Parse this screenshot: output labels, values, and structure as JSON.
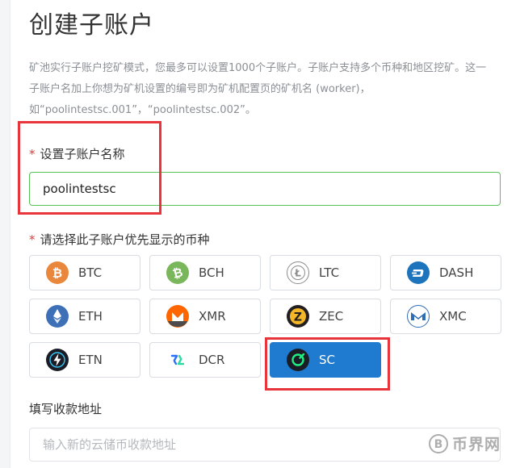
{
  "page": {
    "title": "创建子账户",
    "intro_lines": [
      "矿池实行子账户挖矿模式，您最多可以设置1000个子账户。子账户支持多个币种和地区挖矿。这一",
      "子账户名加上你想为矿机设置的编号即为矿机配置页的矿机名 (worker)，",
      "如“poolintestsc.001”，“poolintestsc.002”。"
    ]
  },
  "form": {
    "required_mark": "*",
    "name_label": "设置子账户名称",
    "name_value": "poolintestsc",
    "coin_label": "请选择此子账户优先显示的币种",
    "address_label": "填写收款地址",
    "address_placeholder": "输入新的云储币收款地址"
  },
  "coins": [
    {
      "name": "BTC",
      "icon": "btc-icon",
      "color": "#e9873c",
      "selected": false
    },
    {
      "name": "BCH",
      "icon": "bch-icon",
      "color": "#7ab75c",
      "selected": false
    },
    {
      "name": "LTC",
      "icon": "ltc-icon",
      "color": "#8c8c8c",
      "selected": false
    },
    {
      "name": "DASH",
      "icon": "dash-icon",
      "color": "#1c75bc",
      "selected": false
    },
    {
      "name": "ETH",
      "icon": "eth-icon",
      "color": "#3e70b7",
      "selected": false
    },
    {
      "name": "XMR",
      "icon": "xmr-icon",
      "color": "#ff6600",
      "selected": false
    },
    {
      "name": "ZEC",
      "icon": "zec-icon",
      "color": "#231f20",
      "selected": false
    },
    {
      "name": "XMC",
      "icon": "xmc-icon",
      "color": "#2e6db4",
      "selected": false
    },
    {
      "name": "ETN",
      "icon": "etn-icon",
      "color": "#1b1d26",
      "selected": false
    },
    {
      "name": "DCR",
      "icon": "dcr-icon",
      "color": "#2970ff",
      "selected": false
    },
    {
      "name": "SC",
      "icon": "sc-icon",
      "color": "#20ee82",
      "selected": true
    }
  ],
  "watermark": {
    "text": "币界网"
  },
  "colors": {
    "accent": "#1f7bd0",
    "highlight": "#e8353b",
    "valid": "#57c255",
    "required": "#e03c3c"
  }
}
